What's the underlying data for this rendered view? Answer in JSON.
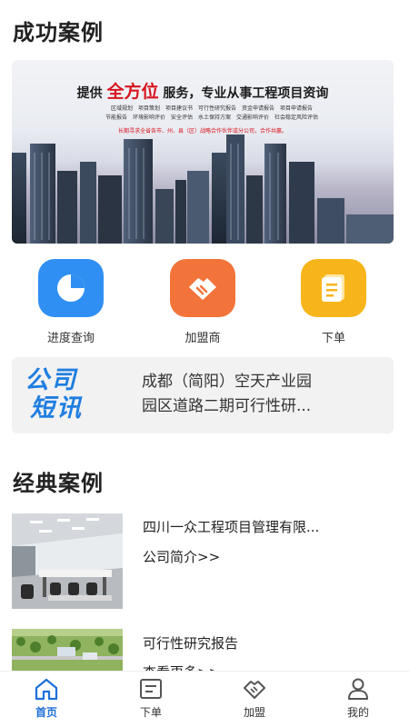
{
  "section_success": "成功案例",
  "banner": {
    "prefix": "提供",
    "highlight": "全方位",
    "suffix": "服务，专业从事工程项目资询",
    "line1": "区域规划　项目策划　项目建议书　可行性研究报告　资金申请报告　项目申请报告",
    "line2": "节能报告　环境影响评价　安全评估　水土保持方案　交通影响评价　社会稳定风险评估",
    "note": "长期寻求全省各市、州、县（区）战略合作伙伴或分公司，合作共赢。"
  },
  "quick": [
    {
      "label": "进度查询",
      "icon": "pie-chart-icon",
      "color": "#2f8ff2"
    },
    {
      "label": "加盟商",
      "icon": "handshake-icon",
      "color": "#f2743a"
    },
    {
      "label": "下单",
      "icon": "document-icon",
      "color": "#f7b51b"
    }
  ],
  "news": {
    "logo_line1": "公司",
    "logo_line2": "短讯",
    "line1": "成都（简阳）空天产业园",
    "line2": "园区道路二期可行性研..."
  },
  "section_classic": "经典案例",
  "cases": [
    {
      "title": "四川一众工程项目管理有限...",
      "link": "公司简介>>"
    },
    {
      "title": "可行性研究报告",
      "link": "查看更多>>"
    }
  ],
  "tabs": [
    {
      "label": "首页",
      "icon": "home-icon",
      "active": true
    },
    {
      "label": "下单",
      "icon": "order-icon",
      "active": false
    },
    {
      "label": "加盟",
      "icon": "handshake-icon",
      "active": false
    },
    {
      "label": "我的",
      "icon": "user-icon",
      "active": false
    }
  ],
  "colors": {
    "accent": "#1f6fd8",
    "red": "#d8151f"
  }
}
